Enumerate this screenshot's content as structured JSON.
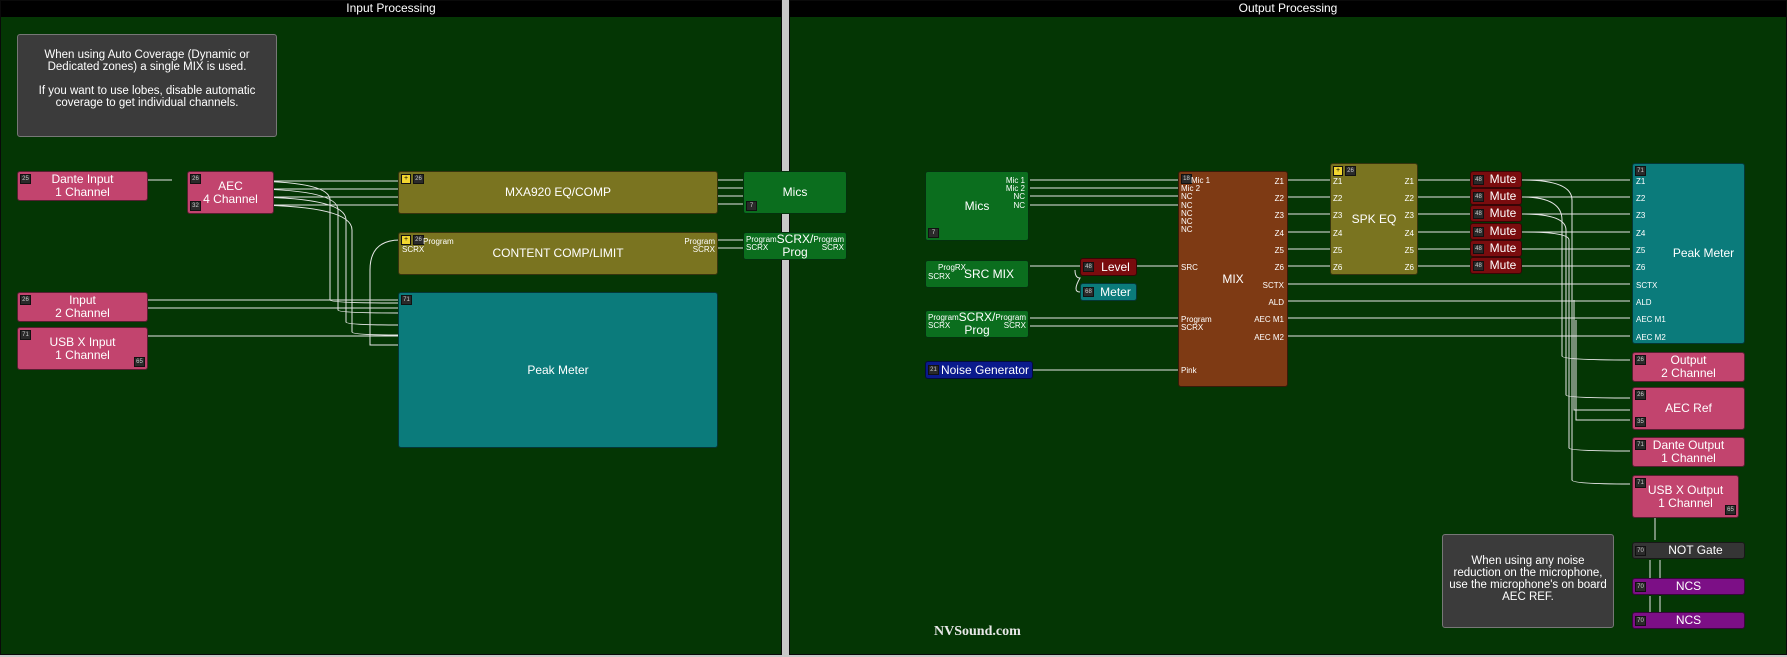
{
  "colors": {
    "canvas": "#043604",
    "title_bar": "#000000",
    "pink": "#c2446e",
    "olive": "#7a7420",
    "green": "#0b6e1e",
    "teal": "#0b7b7b",
    "brown": "#7e3a14",
    "maroon": "#7a0c0e",
    "navy": "#0a1a8c",
    "purple": "#7c0f86",
    "wire": "#e6e6e6"
  },
  "input": {
    "title": "Input Processing",
    "note": {
      "line1": "When using Auto Coverage (Dynamic or Dedicated zones) a single MIX is used.",
      "line2": "If you want to use lobes, disable automatic coverage to get individual channels."
    },
    "dante_input": {
      "l1": "Dante Input",
      "l2": "1 Channel"
    },
    "aec": {
      "l1": "AEC",
      "l2": "4 Channel"
    },
    "eq": {
      "label": "MXA920 EQ/COMP"
    },
    "mics": {
      "label": "Mics"
    },
    "content": {
      "label": "CONTENT COMP/LIMIT",
      "in1": "Program",
      "in2": "SCRX",
      "out1": "Program",
      "out2": "SCRX"
    },
    "scrx": {
      "l1": "SCRX/",
      "l2": "Prog",
      "in1": "Program",
      "in2": "SCRX",
      "out1": "Program",
      "out2": "SCRX"
    },
    "input2": {
      "l1": "Input",
      "l2": "2 Channel"
    },
    "usb_input": {
      "l1": "USB X Input",
      "l2": "1 Channel"
    },
    "peak": {
      "label": "Peak Meter"
    }
  },
  "output": {
    "title": "Output Processing",
    "mics": {
      "label": "Mics",
      "ports": [
        "Mic 1",
        "Mic 2",
        "NC",
        "NC"
      ]
    },
    "src_mix": {
      "label": "SRC MIX",
      "in1": "ProgRX",
      "in2": "SCRX"
    },
    "level": {
      "label": "Level"
    },
    "meter": {
      "label": "Meter"
    },
    "scrx": {
      "l1": "SCRX/",
      "l2": "Prog",
      "in1": "Program",
      "in2": "SCRX",
      "out1": "Program",
      "out2": "SCRX"
    },
    "noise": {
      "label": "Noise Generator"
    },
    "mix": {
      "label": "MIX",
      "inputs": [
        "Mic 1",
        "Mic 2",
        "NC",
        "NC",
        "NC",
        "NC",
        "NC"
      ],
      "src": "SRC",
      "program": "Program",
      "scrx": "SCRX",
      "pink": "Pink",
      "outputs": [
        "Z1",
        "Z2",
        "Z3",
        "Z4",
        "Z5",
        "Z6",
        "SCTX",
        "ALD",
        "AEC M1",
        "AEC M2"
      ]
    },
    "spk_eq": {
      "label": "SPK EQ",
      "ports": [
        "Z1",
        "Z2",
        "Z3",
        "Z4",
        "Z5",
        "Z6"
      ]
    },
    "mutes": [
      "Mute",
      "Mute",
      "Mute",
      "Mute",
      "Mute",
      "Mute"
    ],
    "peak": {
      "label": "Peak Meter",
      "ports": [
        "Z1",
        "Z2",
        "Z3",
        "Z4",
        "Z5",
        "Z6",
        "SCTX",
        "ALD",
        "AEC M1",
        "AEC M2"
      ]
    },
    "out2": {
      "l1": "Output",
      "l2": "2 Channel"
    },
    "aec_ref": {
      "label": "AEC Ref"
    },
    "dante_out": {
      "l1": "Dante Output",
      "l2": "1 Channel"
    },
    "usb_out": {
      "l1": "USB X Output",
      "l2": "1 Channel"
    },
    "not_gate": {
      "label": "NOT Gate"
    },
    "ncs1": {
      "label": "NCS"
    },
    "ncs2": {
      "label": "NCS"
    },
    "note": {
      "text": "When using any noise reduction on the microphone, use the microphone's on board AEC REF."
    },
    "brand": "NVSound.com"
  }
}
